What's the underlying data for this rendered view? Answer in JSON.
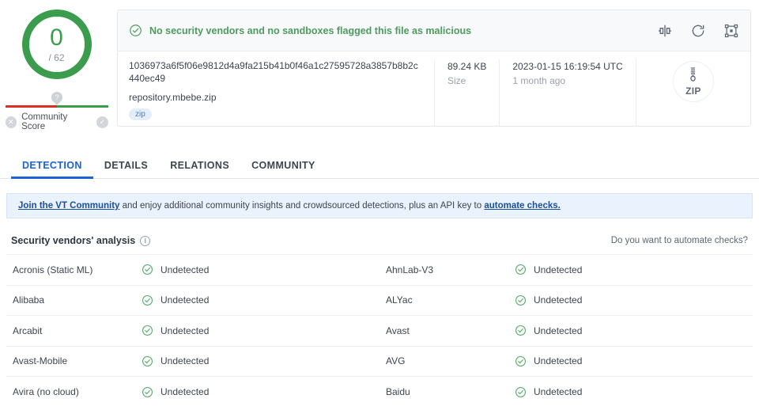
{
  "score": {
    "detections": "0",
    "total": "/ 62",
    "ring_color": "#3b9c4e",
    "community_label": "Community Score",
    "negative_icon": "x-circle-icon",
    "positive_icon": "check-circle-icon",
    "pin_icon": "question-pin-icon"
  },
  "verdict": {
    "icon": "check-circle-icon",
    "text": "No security vendors and no sandboxes flagged this file as malicious",
    "color": "#4e9a5f",
    "actions": [
      {
        "name": "similar-files-icon",
        "title": "Similar"
      },
      {
        "name": "reanalyze-icon",
        "title": "Reanalyze"
      },
      {
        "name": "graph-icon",
        "title": "Graph"
      }
    ]
  },
  "file": {
    "hash": "1036973a6f5f06e9812d4a9fa215b41b0f46a1c27595728a3857b8b2c440ec49",
    "name": "repository.mbebe.zip",
    "tag": "zip",
    "size_value": "89.24 KB",
    "size_label": "Size",
    "date_value": "2023-01-15 16:19:54 UTC",
    "date_label": "1 month ago",
    "type_badge": "ZIP"
  },
  "tabs": [
    {
      "label": "DETECTION",
      "active": true
    },
    {
      "label": "DETAILS",
      "active": false
    },
    {
      "label": "RELATIONS",
      "active": false
    },
    {
      "label": "COMMUNITY",
      "active": false
    }
  ],
  "banner": {
    "link1": "Join the VT Community",
    "middle": " and enjoy additional community insights and crowdsourced detections, plus an API key to ",
    "link2": "automate checks.",
    "bg": "#eaf2fd"
  },
  "analysis": {
    "title": "Security vendors' analysis",
    "info_icon": "info-icon",
    "automate_link": "Do you want to automate checks?",
    "rows": [
      {
        "left_vendor": "Acronis (Static ML)",
        "left_result": "Undetected",
        "right_vendor": "AhnLab-V3",
        "right_result": "Undetected"
      },
      {
        "left_vendor": "Alibaba",
        "left_result": "Undetected",
        "right_vendor": "ALYac",
        "right_result": "Undetected"
      },
      {
        "left_vendor": "Arcabit",
        "left_result": "Undetected",
        "right_vendor": "Avast",
        "right_result": "Undetected"
      },
      {
        "left_vendor": "Avast-Mobile",
        "left_result": "Undetected",
        "right_vendor": "AVG",
        "right_result": "Undetected"
      },
      {
        "left_vendor": "Avira (no cloud)",
        "left_result": "Undetected",
        "right_vendor": "Baidu",
        "right_result": "Undetected"
      }
    ]
  }
}
